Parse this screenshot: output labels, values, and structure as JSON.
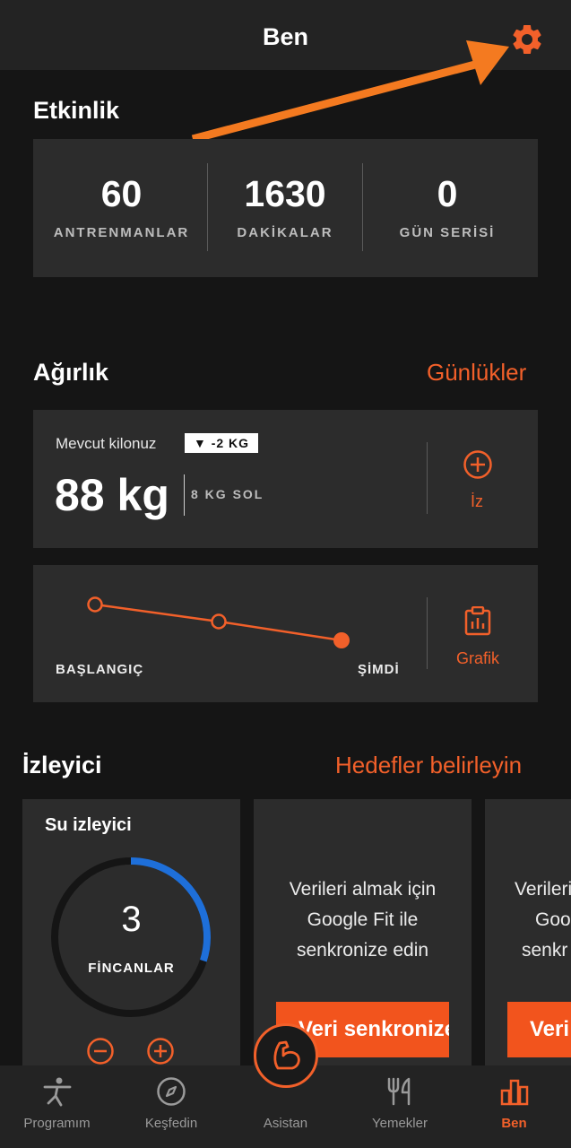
{
  "header": {
    "title": "Ben",
    "settings_icon": "gear-icon"
  },
  "activity": {
    "section_title": "Etkinlik",
    "stats": [
      {
        "value": "60",
        "label": "ANTRENMANLAR"
      },
      {
        "value": "1630",
        "label": "DAKİKALAR"
      },
      {
        "value": "0",
        "label": "GÜN SERİSİ"
      }
    ]
  },
  "weight": {
    "section_title": "Ağırlık",
    "logs_link": "Günlükler",
    "current_caption": "Mevcut kilonuz",
    "delta_badge": "▼ -2 KG",
    "current_value": "88 kg",
    "left_to_goal": "8 KG SOL",
    "track_label": "İz",
    "graph": {
      "start_label": "BAŞLANGIÇ",
      "now_label": "ŞİMDİ",
      "chart_label": "Grafik"
    }
  },
  "trackers": {
    "section_title": "İzleyici",
    "goals_link": "Hedefler belirleyin",
    "water": {
      "title": "Su izleyici",
      "cups": "3",
      "unit": "FİNCANLAR",
      "progress": 0.3
    },
    "sync_card": {
      "text_line1": "Verileri almak için",
      "text_line2": "Google Fit ile",
      "text_line3": "senkronize edin",
      "button": "Veri senkronize et"
    },
    "sync_card_partial": {
      "text_line1": "Verileri",
      "text_line2": "Goo",
      "text_line3": "senkr",
      "button": "Veri"
    }
  },
  "bottom_nav": [
    {
      "label": "Programım",
      "icon": "exercise-figure-icon",
      "active": false
    },
    {
      "label": "Keşfedin",
      "icon": "compass-icon",
      "active": false
    },
    {
      "label": "Asistan",
      "icon": "flexed-arm-icon",
      "active": false
    },
    {
      "label": "Yemekler",
      "icon": "fork-knife-icon",
      "active": false
    },
    {
      "label": "Ben",
      "icon": "bar-chart-icon",
      "active": true
    }
  ],
  "colors": {
    "accent": "#f2602a",
    "button": "#f2541d",
    "card": "#2c2c2c",
    "background": "#151515",
    "water_progress": "#1e6fd9"
  }
}
